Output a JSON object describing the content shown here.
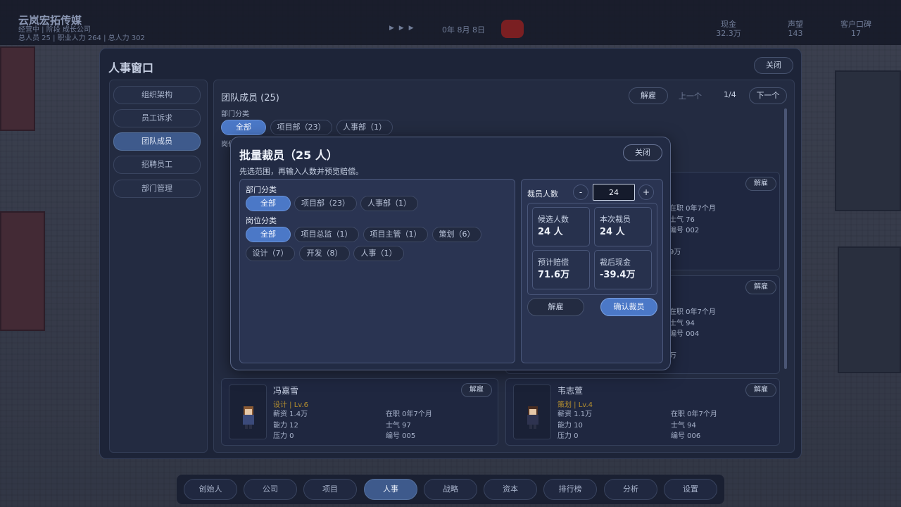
{
  "hud": {
    "company": "云岚宏拓传媒",
    "status_line": "经营中 | 阶段 成长公司",
    "stats_line": "总人员 25 | 职业人力 264 | 总人力 302",
    "date": "0年 8月 8日",
    "stats": [
      {
        "label": "现金",
        "value": "32.3万"
      },
      {
        "label": "声望",
        "value": "143"
      },
      {
        "label": "客户口碑",
        "value": "17"
      }
    ]
  },
  "hr_window": {
    "title": "人事窗口",
    "close_label": "关闭",
    "sidebar": [
      {
        "label": "组织架构",
        "active": false
      },
      {
        "label": "员工诉求",
        "active": false
      },
      {
        "label": "团队成员",
        "active": true
      },
      {
        "label": "招聘员工",
        "active": false
      },
      {
        "label": "部门管理",
        "active": false
      }
    ],
    "team_title": "团队成员 (25)",
    "fire_label": "解雇",
    "prev_label": "上一个",
    "page": "1/4",
    "next_label": "下一个",
    "dept_label": "部门分类",
    "dept_filters": [
      "全部",
      "项目部（23）",
      "人事部（1）"
    ],
    "position_label_partial": "岗位",
    "behind_right": [
      {
        "tenure": "在职 0年7个月",
        "morale": "士气 76",
        "id": "编号 002",
        "extra": "9万",
        "fire": "解雇"
      },
      {
        "tenure": "在职 0年7个月",
        "morale": "士气 94",
        "id": "编号 004",
        "extra": "万",
        "fire": "解雇"
      }
    ],
    "employees": [
      {
        "name": "冯嘉雪",
        "tag": "设计 | Lv.6",
        "salary": "薪资 1.4万",
        "ability": "能力 12",
        "stress": "压力 0",
        "tenure": "在职 0年7个月",
        "morale": "士气 97",
        "id": "编号 005",
        "fire": "解雇"
      },
      {
        "name": "韦志萱",
        "tag": "策划 | Lv.4",
        "salary": "薪资 1.1万",
        "ability": "能力 10",
        "stress": "压力 0",
        "tenure": "在职 0年7个月",
        "morale": "士气 94",
        "id": "编号 006",
        "fire": "解雇"
      }
    ]
  },
  "modal": {
    "title": "批量裁员（25 人）",
    "close_label": "关闭",
    "description": "先选范围，再输入人数并预览赔偿。",
    "dept_label": "部门分类",
    "dept_filters": [
      {
        "label": "全部",
        "active": true
      },
      {
        "label": "项目部（23）",
        "active": false
      },
      {
        "label": "人事部（1）",
        "active": false
      }
    ],
    "position_label": "岗位分类",
    "position_filters": [
      {
        "label": "全部",
        "active": true
      },
      {
        "label": "项目总监（1）",
        "active": false
      },
      {
        "label": "项目主管（1）",
        "active": false
      },
      {
        "label": "策划（6）",
        "active": false
      },
      {
        "label": "设计（7）",
        "active": false
      },
      {
        "label": "开发（8）",
        "active": false
      },
      {
        "label": "人事（1）",
        "active": false
      }
    ],
    "count_label": "裁员人数",
    "minus": "-",
    "plus": "+",
    "count_value": "24",
    "stats": [
      {
        "label": "候选人数",
        "value": "24 人"
      },
      {
        "label": "本次裁员",
        "value": "24 人"
      },
      {
        "label": "预计赔偿",
        "value": "71.6万"
      },
      {
        "label": "裁后现金",
        "value": "-39.4万"
      }
    ],
    "fire_label": "解雇",
    "confirm_label": "确认裁员"
  },
  "bottom_nav": [
    {
      "label": "创始人",
      "active": false
    },
    {
      "label": "公司",
      "active": false
    },
    {
      "label": "项目",
      "active": false
    },
    {
      "label": "人事",
      "active": true
    },
    {
      "label": "战略",
      "active": false
    },
    {
      "label": "资本",
      "active": false
    },
    {
      "label": "排行榜",
      "active": false
    },
    {
      "label": "分析",
      "active": false
    },
    {
      "label": "设置",
      "active": false
    }
  ],
  "colors": {
    "accent": "#4b78c7",
    "danger_indicator": "#7a1f22"
  }
}
